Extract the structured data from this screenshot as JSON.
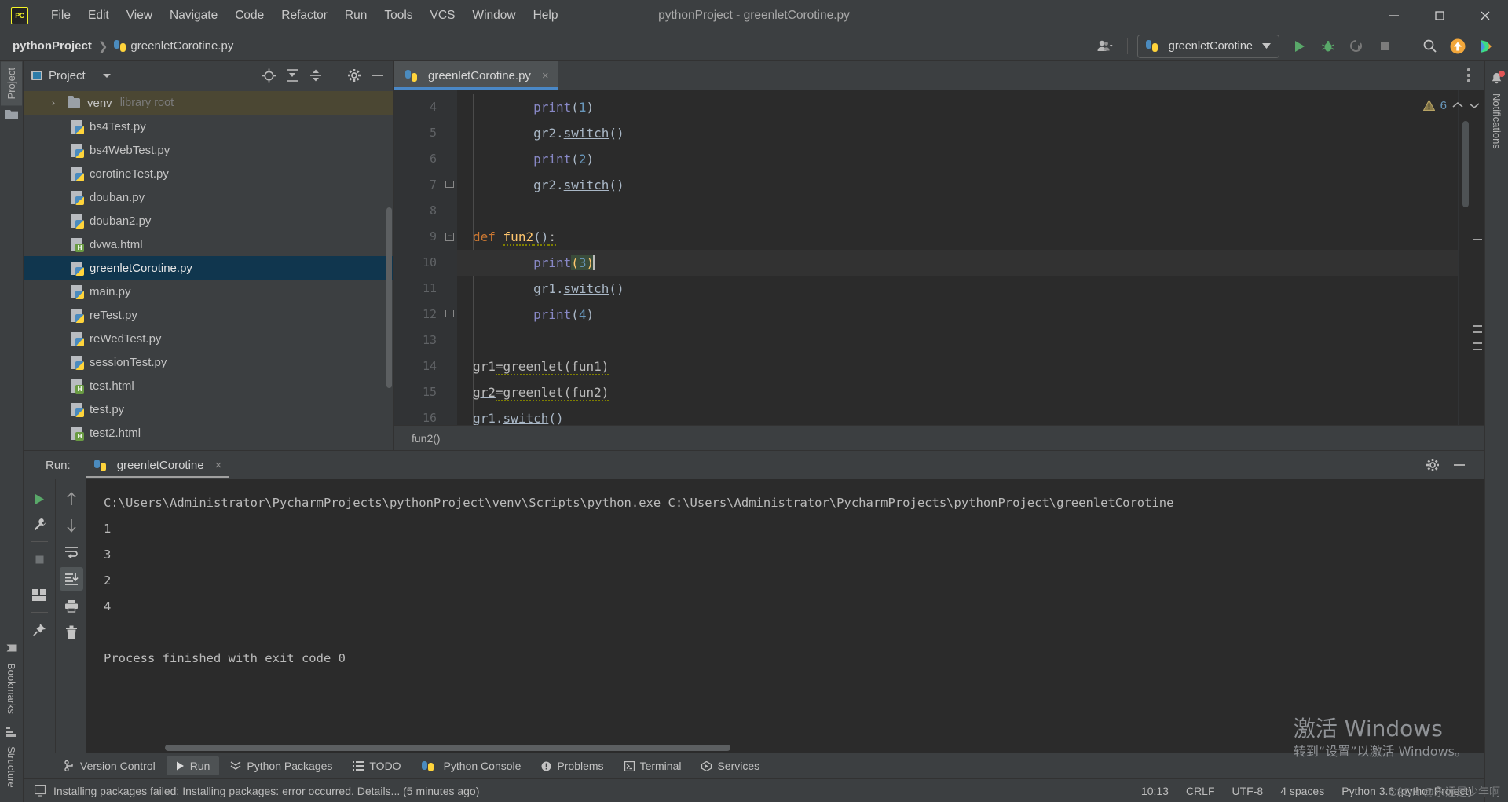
{
  "window": {
    "title": "pythonProject - greenletCorotine.py",
    "controls": [
      "minimize",
      "maximize",
      "close"
    ]
  },
  "menubar": {
    "logo": "pycharm-logo",
    "items": [
      {
        "label": "File",
        "mnemonic": "F"
      },
      {
        "label": "Edit",
        "mnemonic": "E"
      },
      {
        "label": "View",
        "mnemonic": "V"
      },
      {
        "label": "Navigate",
        "mnemonic": "N"
      },
      {
        "label": "Code",
        "mnemonic": "C"
      },
      {
        "label": "Refactor",
        "mnemonic": "R"
      },
      {
        "label": "Run",
        "mnemonic": "u"
      },
      {
        "label": "Tools",
        "mnemonic": "T"
      },
      {
        "label": "VCS",
        "mnemonic": "S"
      },
      {
        "label": "Window",
        "mnemonic": "W"
      },
      {
        "label": "Help",
        "mnemonic": "H"
      }
    ]
  },
  "navbar": {
    "breadcrumbs": [
      {
        "label": "pythonProject",
        "icon": null
      },
      {
        "label": "greenletCorotine.py",
        "icon": "python-file-icon"
      }
    ],
    "run_config": {
      "label": "greenletCorotine",
      "icon": "python-icon"
    },
    "buttons": [
      "user-icon",
      "run-icon",
      "debug-icon",
      "coverage-icon",
      "stop-icon",
      "search-icon",
      "update-icon",
      "datagrip-icon"
    ]
  },
  "left_strip": {
    "top": [
      {
        "label": "Project",
        "active": true
      }
    ],
    "bottom": [
      {
        "label": "Bookmarks"
      },
      {
        "label": "Structure"
      }
    ]
  },
  "right_strip": {
    "items": [
      {
        "label": "Notifications",
        "badge": true
      }
    ]
  },
  "project_panel": {
    "title": "Project",
    "actions": [
      "locate-icon",
      "expand-all-icon",
      "collapse-all-icon",
      "settings-icon",
      "hide-icon"
    ],
    "tree": [
      {
        "label": "venv",
        "suffix": "library root",
        "icon": "folder-icon",
        "arrow": "›",
        "highlight": true,
        "indent": 0
      },
      {
        "label": "bs4Test.py",
        "icon": "python-file-icon",
        "indent": 1
      },
      {
        "label": "bs4WebTest.py",
        "icon": "python-file-icon",
        "indent": 1
      },
      {
        "label": "corotineTest.py",
        "icon": "python-file-icon",
        "indent": 1
      },
      {
        "label": "douban.py",
        "icon": "python-file-icon",
        "indent": 1
      },
      {
        "label": "douban2.py",
        "icon": "python-file-icon",
        "indent": 1
      },
      {
        "label": "dvwa.html",
        "icon": "html-file-icon",
        "indent": 1
      },
      {
        "label": "greenletCorotine.py",
        "icon": "python-file-icon",
        "indent": 1,
        "selected": true
      },
      {
        "label": "main.py",
        "icon": "python-file-icon",
        "indent": 1
      },
      {
        "label": "reTest.py",
        "icon": "python-file-icon",
        "indent": 1
      },
      {
        "label": "reWedTest.py",
        "icon": "python-file-icon",
        "indent": 1
      },
      {
        "label": "sessionTest.py",
        "icon": "python-file-icon",
        "indent": 1
      },
      {
        "label": "test.html",
        "icon": "html-file-icon",
        "indent": 1
      },
      {
        "label": "test.py",
        "icon": "python-file-icon",
        "indent": 1
      },
      {
        "label": "test2.html",
        "icon": "html-file-icon",
        "indent": 1
      }
    ]
  },
  "editor": {
    "tab": {
      "label": "greenletCorotine.py",
      "icon": "python-file-icon",
      "close": "×"
    },
    "warning_count": "6",
    "warning_icon": "warning-triangle-icon",
    "breadcrumb": "fun2()",
    "lines": [
      {
        "no": "4",
        "text": "        print(1)"
      },
      {
        "no": "5",
        "text": "        gr2.switch()"
      },
      {
        "no": "6",
        "text": "        print(2)"
      },
      {
        "no": "7",
        "text": "        gr2.switch()",
        "fold": "end"
      },
      {
        "no": "8",
        "text": ""
      },
      {
        "no": "9",
        "text": "def fun2():",
        "fold": "start"
      },
      {
        "no": "10",
        "text": "        print(3)",
        "current": true,
        "bulb": true
      },
      {
        "no": "11",
        "text": "        gr1.switch()"
      },
      {
        "no": "12",
        "text": "        print(4)",
        "fold": "end"
      },
      {
        "no": "13",
        "text": ""
      },
      {
        "no": "14",
        "text": "gr1=greenlet(fun1)"
      },
      {
        "no": "15",
        "text": "gr2=greenlet(fun2)"
      },
      {
        "no": "16",
        "text": "gr1.switch()"
      }
    ]
  },
  "run_panel": {
    "label": "Run:",
    "tab": {
      "label": "greenletCorotine",
      "icon": "python-icon",
      "close": "×"
    },
    "header_actions": [
      "settings-icon",
      "hide-icon"
    ],
    "left_tools": [
      "rerun-icon",
      "wrench-icon",
      "stop-icon",
      "layout-icon",
      "pin-icon"
    ],
    "right_tools": [
      "up-icon",
      "down-icon",
      "soft-wrap-icon",
      "scroll-to-end-icon",
      "print-icon",
      "clear-all-icon"
    ],
    "console": [
      "C:\\Users\\Administrator\\PycharmProjects\\pythonProject\\venv\\Scripts\\python.exe C:\\Users\\Administrator\\PycharmProjects\\pythonProject\\greenletCorotine",
      "1",
      "3",
      "2",
      "4",
      "",
      "Process finished with exit code 0"
    ]
  },
  "tool_window_bar": {
    "items": [
      {
        "label": "Version Control",
        "icon": "branch-icon",
        "active": false
      },
      {
        "label": "Run",
        "icon": "play-icon",
        "active": true
      },
      {
        "label": "Python Packages",
        "icon": "packages-icon",
        "active": false
      },
      {
        "label": "TODO",
        "icon": "list-icon",
        "active": false
      },
      {
        "label": "Python Console",
        "icon": "python-icon",
        "active": false
      },
      {
        "label": "Problems",
        "icon": "problems-icon",
        "active": false
      },
      {
        "label": "Terminal",
        "icon": "terminal-icon",
        "active": false
      },
      {
        "label": "Services",
        "icon": "services-icon",
        "active": false
      }
    ]
  },
  "status_bar": {
    "icon": "monitor-icon",
    "message": "Installing packages failed: Installing packages: error occurred. Details... (5 minutes ago)",
    "right": [
      {
        "label": "10:13"
      },
      {
        "label": "CRLF"
      },
      {
        "label": "UTF-8"
      },
      {
        "label": "4 spaces"
      },
      {
        "label": "Python 3.6 (pythonProject)"
      }
    ]
  },
  "watermark": {
    "line1": "激活 Windows",
    "line2": "转到“设置”以激活 Windows。",
    "csdn": "CSDN @永远是少年啊"
  },
  "colors": {
    "accent_blue": "#4a88c7",
    "selection": "#10364e",
    "venv_highlight": "#4b4733",
    "editor_bg": "#2b2b2b",
    "panel_bg": "#3c3f41",
    "keyword": "#cc7832",
    "function": "#ffc66d",
    "builtin": "#8888c6",
    "number": "#6897bb"
  }
}
